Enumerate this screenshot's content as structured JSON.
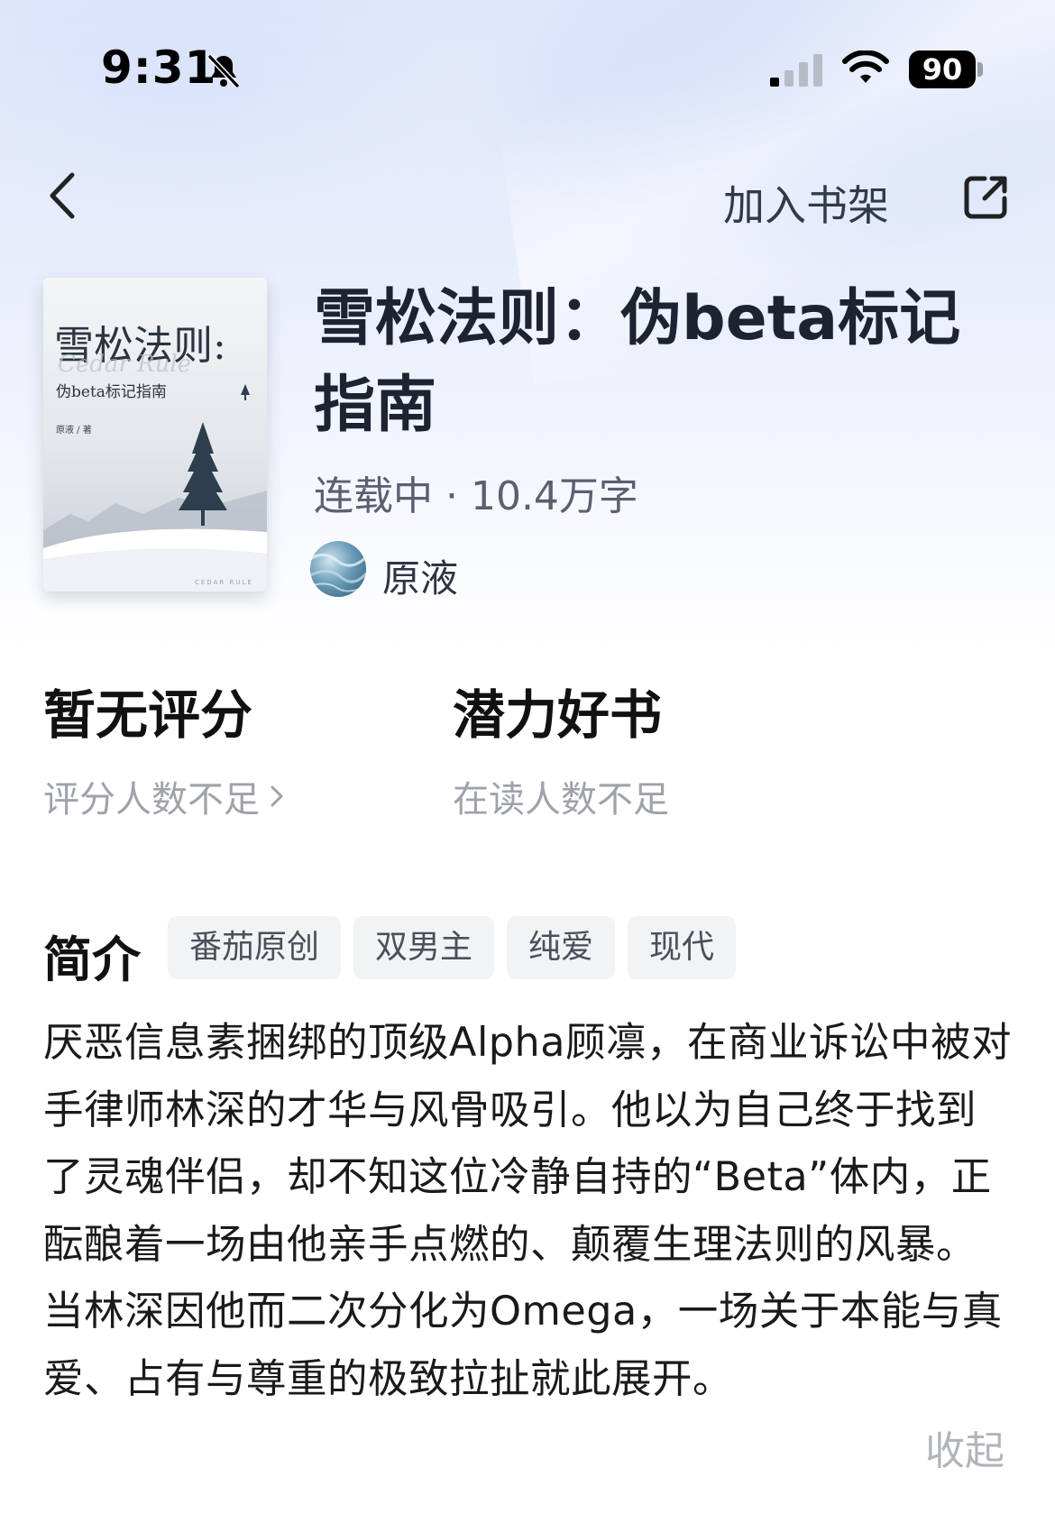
{
  "status_bar": {
    "time": "9:31",
    "battery": "90",
    "icons": [
      "bell-slash-icon",
      "cellular-signal-icon",
      "wifi-icon",
      "battery-icon"
    ]
  },
  "nav": {
    "back_icon": "chevron-left-icon",
    "add_to_shelf": "加入书架",
    "share_icon": "share-icon"
  },
  "book": {
    "cover": {
      "title_line1": "雪松法则:",
      "title_line2": "伪beta标记指南",
      "author_mark": "原液 / 著",
      "script_text": "Cedar Rule",
      "footer_text": "CEDAR RULE"
    },
    "title": "雪松法则：伪beta标记指南",
    "meta": "连载中 · 10.4万字",
    "author": "原液"
  },
  "stats": {
    "rating": {
      "main": "暂无评分",
      "sub": "评分人数不足"
    },
    "potential": {
      "main": "潜力好书",
      "sub": "在读人数不足"
    }
  },
  "intro": {
    "label": "简介",
    "tags": [
      "番茄原创",
      "双男主",
      "纯爱",
      "现代"
    ],
    "summary": "厌恶信息素捆绑的顶级Alpha顾凛，在商业诉讼中被对手律师林深的才华与风骨吸引。他以为自己终于找到了灵魂伴侣，却不知这位冷静自持的“Beta”体内，正酝酿着一场由他亲手点燃的、颠覆生理法则的风暴。当林深因他而二次分化为Omega，一场关于本能与真爱、占有与尊重的极致拉扯就此展开。",
    "collapse": "收起"
  },
  "colors": {
    "hero_top": "#dfe6fa",
    "title_text": "#1d2330",
    "secondary_text": "#9ea2aa",
    "tag_bg": "#f2f3f5"
  }
}
